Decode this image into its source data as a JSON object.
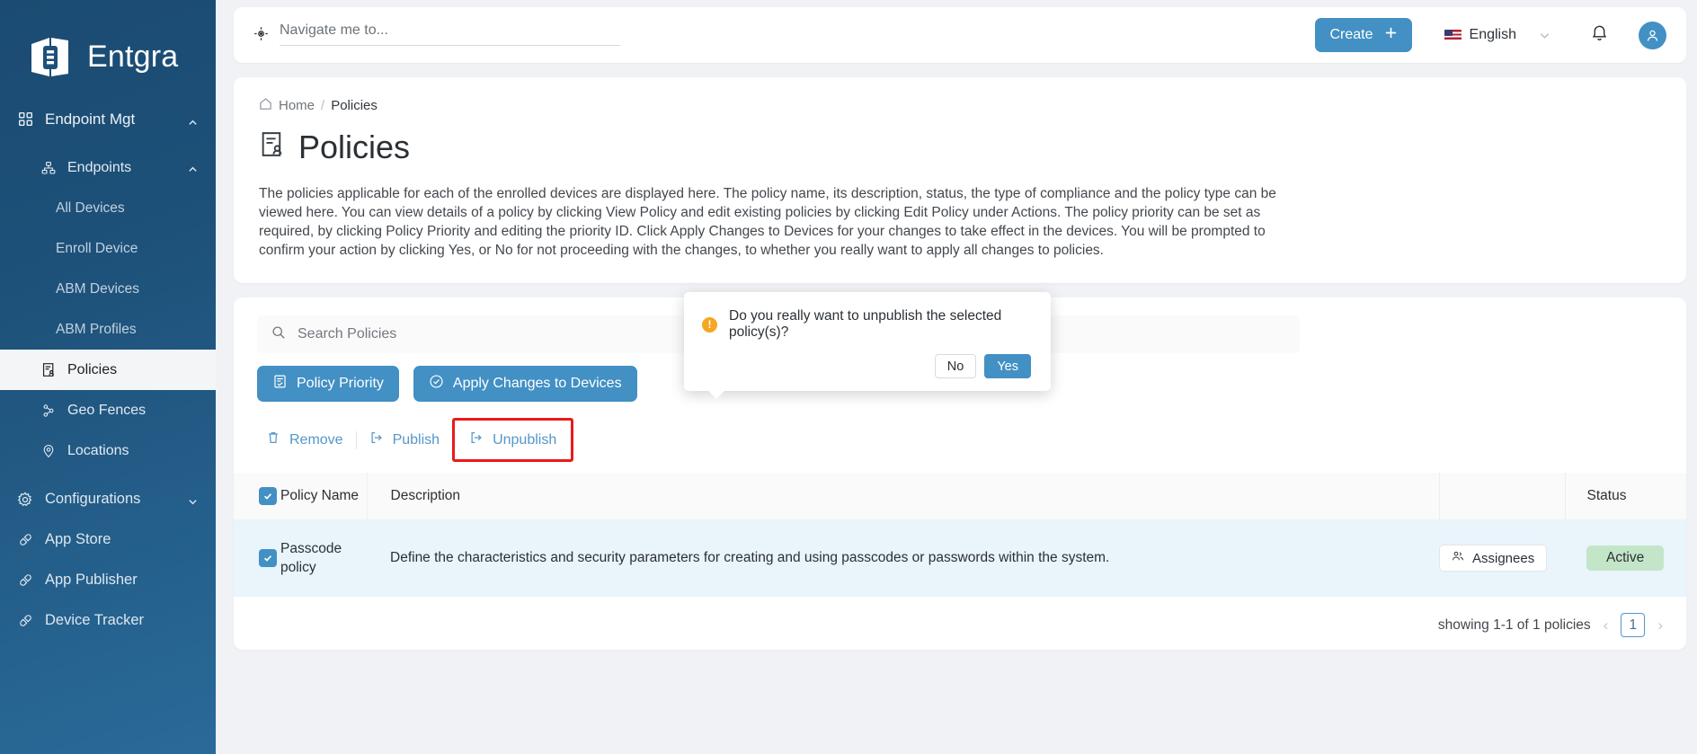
{
  "brand": {
    "name": "Entgra",
    "logo_icon": "entgra-logo-icon"
  },
  "sidebar": {
    "items": [
      {
        "label": "Endpoint Mgt",
        "icon": "grid-icon",
        "level": 0,
        "expanded": true,
        "chevron": "chevron-up-icon",
        "active": false
      },
      {
        "label": "Endpoints",
        "icon": "sitemap-icon",
        "level": 1,
        "expanded": true,
        "chevron": "chevron-up-icon",
        "active": false
      },
      {
        "label": "All Devices",
        "icon": "",
        "level": 2,
        "active": false
      },
      {
        "label": "Enroll Device",
        "icon": "",
        "level": 2,
        "active": false
      },
      {
        "label": "ABM Devices",
        "icon": "",
        "level": 2,
        "active": false
      },
      {
        "label": "ABM Profiles",
        "icon": "",
        "level": 2,
        "active": false
      },
      {
        "label": "Policies",
        "icon": "policy-icon",
        "level": 1,
        "active": true
      },
      {
        "label": "Geo Fences",
        "icon": "geofence-icon",
        "level": 1,
        "active": false
      },
      {
        "label": "Locations",
        "icon": "location-pin-icon",
        "level": 1,
        "active": false
      },
      {
        "label": "Configurations",
        "icon": "gear-icon",
        "level": 0,
        "expanded": false,
        "chevron": "chevron-down-icon",
        "active": false
      },
      {
        "label": "App Store",
        "icon": "plug-icon",
        "level": 0,
        "active": false
      },
      {
        "label": "App Publisher",
        "icon": "plug-icon",
        "level": 0,
        "active": false
      },
      {
        "label": "Device Tracker",
        "icon": "plug-icon",
        "level": 0,
        "active": false
      }
    ]
  },
  "header": {
    "nav_search_placeholder": "Navigate me to...",
    "nav_search_value": "",
    "nav_search_icon": "navigate-target-icon",
    "create_label": "Create",
    "create_icon": "plus-icon",
    "language": "English",
    "language_flag": "us-flag-icon",
    "language_chevron": "chevron-down-icon",
    "notifications_icon": "bell-icon",
    "avatar_icon": "user-avatar-icon"
  },
  "breadcrumb": {
    "home": "Home",
    "separator": "/",
    "current": "Policies",
    "home_icon": "home-icon"
  },
  "page": {
    "title": "Policies",
    "title_icon": "policy-icon",
    "description": "The policies applicable for each of the enrolled devices are displayed here. The policy name, its description, status, the type of compliance and the policy type can be viewed here. You can view details of a policy by clicking View Policy and edit existing policies by clicking Edit Policy under Actions. The policy priority can be set as required, by clicking Policy Priority and editing the priority ID. Click Apply Changes to Devices for your changes to take effect in the devices. You will be prompted to confirm your action by clicking Yes, or No for not proceeding with the changes, to whether you really want to apply all changes to policies."
  },
  "toolbar": {
    "search_placeholder": "Search Policies",
    "search_value": "",
    "search_icon": "search-icon",
    "policy_priority_label": "Policy Priority",
    "policy_priority_icon": "list-doc-icon",
    "apply_changes_label": "Apply Changes to Devices",
    "apply_changes_icon": "check-circle-icon"
  },
  "actions": {
    "remove_label": "Remove",
    "remove_icon": "trash-icon",
    "publish_label": "Publish",
    "publish_icon": "publish-icon",
    "unpublish_label": "Unpublish",
    "unpublish_icon": "unpublish-icon",
    "highlight_color": "#e81b1b"
  },
  "popup": {
    "message": "Do you really want to unpublish the selected policy(s)?",
    "warning_icon": "warning-icon",
    "no_label": "No",
    "yes_label": "Yes"
  },
  "table": {
    "select_all_checked": true,
    "columns": [
      {
        "key": "name",
        "label": "Policy Name"
      },
      {
        "key": "description",
        "label": "Description"
      },
      {
        "key": "assignees",
        "label": ""
      },
      {
        "key": "status",
        "label": "Status"
      }
    ],
    "rows": [
      {
        "checked": true,
        "name": "Passcode policy",
        "description": "Define the characteristics and security parameters for creating and using passcodes or passwords within the system.",
        "assignees_label": "Assignees",
        "assignees_icon": "people-icon",
        "status": "Active",
        "status_color": "#c3e6c8"
      }
    ]
  },
  "pagination": {
    "summary": "showing 1-1 of 1 policies",
    "prev_icon": "chevron-left-icon",
    "next_icon": "chevron-right-icon",
    "current_page": "1"
  },
  "colors": {
    "accent": "#4290c4",
    "sidebar": "#1d5179",
    "row_selected": "#e9f4fb"
  }
}
